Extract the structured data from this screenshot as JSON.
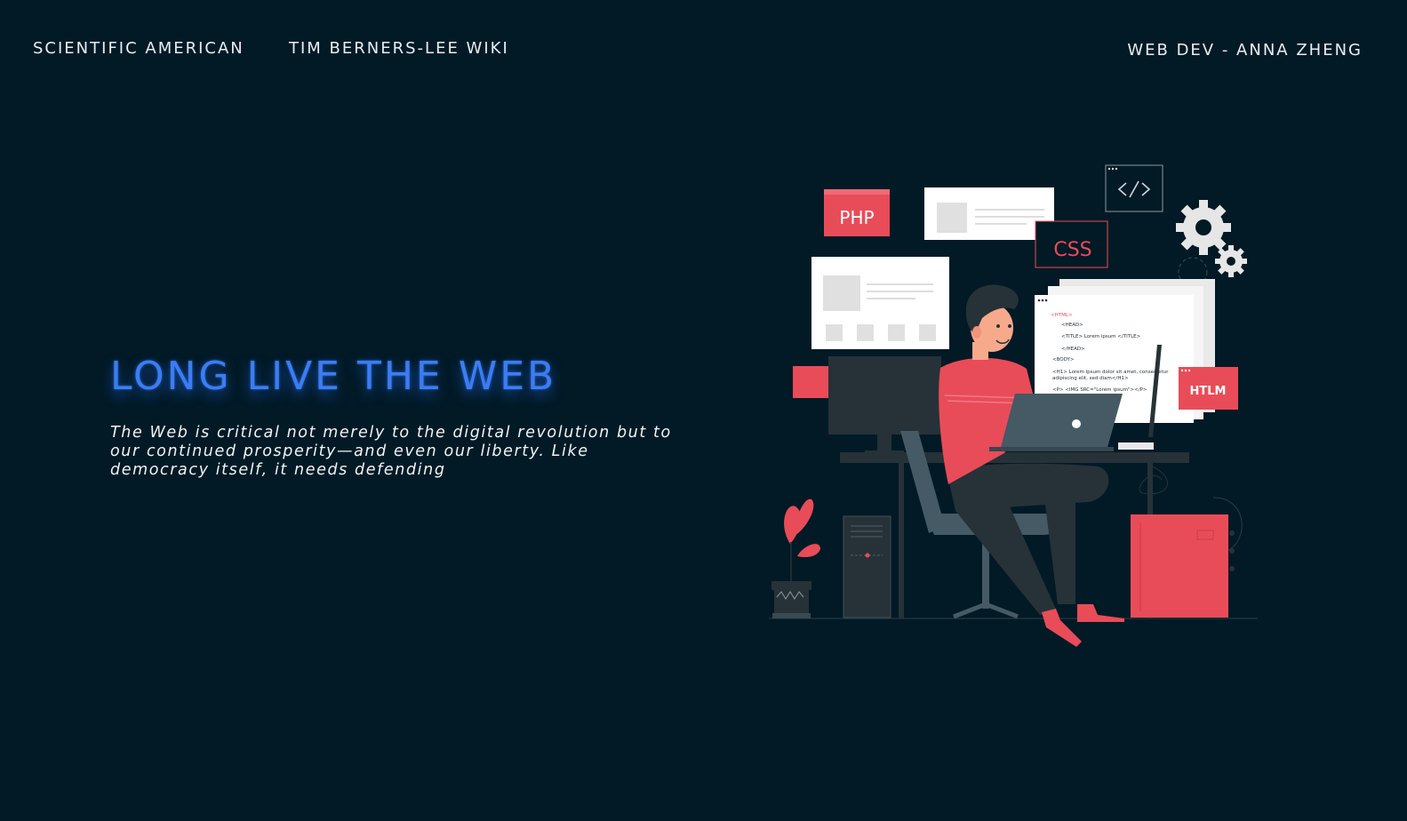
{
  "nav": {
    "links": [
      "SCIENTIFIC AMERICAN",
      "TIM BERNERS-LEE WIKI"
    ],
    "author": "WEB DEV - ANNA ZHENG"
  },
  "hero": {
    "title": "LONG LIVE THE WEB",
    "text": "The Web is critical not merely to the digital revolution but to our continued prosperity—and even our liberty. Like democracy itself, it needs defending"
  },
  "illustration": {
    "tags": {
      "php": "PHP",
      "css": "CSS",
      "htlm": "HTLM"
    },
    "code_lines": [
      "<HTML>",
      "<HEAD>",
      "<TITLE> Lorem ipsum </TITLE>",
      "</HEAD>",
      "<BODY>",
      "<H1> Lorem ipsum dolor sit amet, consectetur",
      "adipiscing elit, sed diam</H1>",
      "<P> <IMG SRC=\"Lorem ipsum\"></P>"
    ],
    "colors": {
      "accent": "#e84c58",
      "dark": "#263238",
      "light": "#ffffff",
      "background": "#021a26",
      "title": "#3c7cf5"
    }
  }
}
